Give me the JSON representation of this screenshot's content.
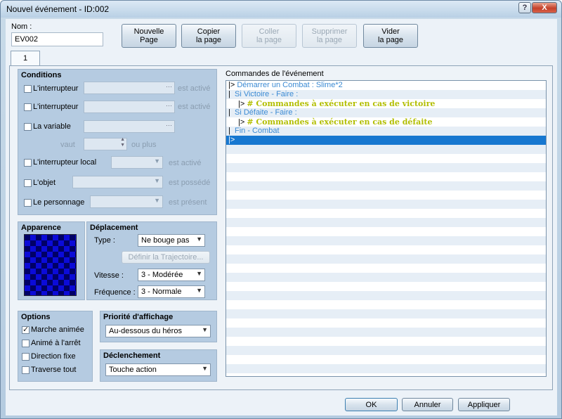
{
  "window": {
    "title": "Nouvel événement - ID:002",
    "help": "?",
    "close": "X"
  },
  "header": {
    "name_label": "Nom :",
    "name_value": "EV002",
    "buttons": [
      {
        "line1": "Nouvelle",
        "line2": "Page",
        "enabled": true
      },
      {
        "line1": "Copier",
        "line2": "la page",
        "enabled": true
      },
      {
        "line1": "Coller",
        "line2": "la page",
        "enabled": false
      },
      {
        "line1": "Supprimer",
        "line2": "la page",
        "enabled": false
      },
      {
        "line1": "Vider",
        "line2": "la page",
        "enabled": true
      }
    ]
  },
  "tabs": [
    {
      "label": "1"
    }
  ],
  "conditions": {
    "title": "Conditions",
    "switch1_label": "L'interrupteur",
    "switch1_suffix": "est activé",
    "switch2_label": "L'interrupteur",
    "switch2_suffix": "est activé",
    "variable_label": "La variable",
    "vaut_label": "vaut",
    "ou_plus_label": "ou plus",
    "local_switch_label": "L'interrupteur local",
    "local_switch_suffix": "est activé",
    "item_label": "L'objet",
    "item_suffix": "est possédé",
    "actor_label": "Le personnage",
    "actor_suffix": "est présent"
  },
  "appearance": {
    "title": "Apparence"
  },
  "movement": {
    "title": "Déplacement",
    "type_label": "Type :",
    "type_value": "Ne bouge pas",
    "route_button": "Définir la Trajectoire...",
    "speed_label": "Vitesse :",
    "speed_value": "3 - Modérée",
    "freq_label": "Fréquence :",
    "freq_value": "3 - Normale"
  },
  "options": {
    "title": "Options",
    "items": [
      {
        "label": "Marche animée",
        "checked": true
      },
      {
        "label": "Animé à l'arrêt",
        "checked": false
      },
      {
        "label": "Direction fixe",
        "checked": false
      },
      {
        "label": "Traverse tout",
        "checked": false
      }
    ]
  },
  "priority": {
    "title": "Priorité d'affichage",
    "value": "Au-dessous du héros"
  },
  "trigger": {
    "title": "Déclenchement",
    "value": "Touche action"
  },
  "commands": {
    "title": "Commandes de l'événement",
    "lines": [
      {
        "prefix": "|>",
        "text": "Démarrer un Combat : Slime*2",
        "style": "blue"
      },
      {
        "prefix": "|",
        "text": "Si Victoire - Faire :",
        "style": "blue"
      },
      {
        "prefix": "|>",
        "text": "# Commandes à exécuter en cas de victoire",
        "style": "green"
      },
      {
        "prefix": "|",
        "text": "Si Défaite - Faire :",
        "style": "blue"
      },
      {
        "prefix": "|>",
        "text": "# Commandes à exécuter en cas de défaite",
        "style": "green"
      },
      {
        "prefix": "|",
        "text": "Fin - Combat",
        "style": "blue"
      },
      {
        "prefix": "|>",
        "text": "",
        "style": "selected"
      }
    ]
  },
  "footer": {
    "ok": "OK",
    "cancel": "Annuler",
    "apply": "Appliquer"
  },
  "colors": {
    "selection": "#1677d0",
    "command_blue": "#3b8ad3",
    "comment_green": "#b2be00",
    "group_bg": "#b5cbe1"
  }
}
